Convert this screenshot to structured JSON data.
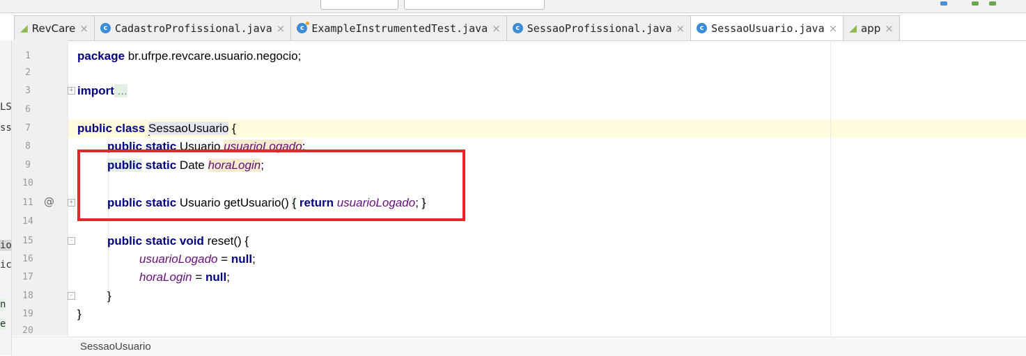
{
  "tabs": [
    {
      "label": "RevCare",
      "icon": "android-icon",
      "active": false
    },
    {
      "label": "CadastroProfissional.java",
      "icon": "java-class-icon",
      "active": false
    },
    {
      "label": "ExampleInstrumentedTest.java",
      "icon": "java-test-class-icon",
      "active": false
    },
    {
      "label": "SessaoProfissional.java",
      "icon": "java-class-icon",
      "active": false
    },
    {
      "label": "SessaoUsuario.java",
      "icon": "java-class-icon",
      "active": true
    },
    {
      "label": "app",
      "icon": "android-icon",
      "active": false
    }
  ],
  "close_glyph": "×",
  "class_icon_letter": "c",
  "left_strip": [
    "LS",
    "ss",
    "io",
    "ic",
    "n",
    "e"
  ],
  "gutter": {
    "line_numbers": [
      "1",
      "2",
      "3",
      "6",
      "7",
      "8",
      "9",
      "10",
      "11",
      "14",
      "15",
      "16",
      "17",
      "18",
      "19",
      "20"
    ],
    "override_marker": "@"
  },
  "code": {
    "l1_kw": "package",
    "l1_rest": " br.ufrpe.revcare.usuario.negocio;",
    "l3_kw": "import",
    "l3_rest": " ...",
    "l7_kw": "public class ",
    "l7_class_first": "S",
    "l7_class_rest": "essaoUsuario",
    "l7_brace": " {",
    "l8_kw": "public static",
    "l8_type": " Usuario ",
    "l8_field": "usuarioLogado",
    "l8_end": ";",
    "l9_kw1": "public",
    "l9_kw2": " static",
    "l9_type": " Date ",
    "l9_field": "horaLogin",
    "l9_end": ";",
    "l11_kw": "public static",
    "l11_type": " Usuario getUsuario() ",
    "l11_lbrace": "{",
    "l11_ret": " return ",
    "l11_field": "usuarioLogado",
    "l11_semi": ";",
    "l11_rbrace": "}",
    "l15_kw": "public static void",
    "l15_rest": " reset() {",
    "l16_field": "usuarioLogado",
    "l16_eq": " = ",
    "l16_null": "null",
    "l16_end": ";",
    "l17_field": "horaLogin",
    "l17_eq": " = ",
    "l17_null": "null",
    "l17_end": ";",
    "l18": "}",
    "l19": "}"
  },
  "breadcrumb": "SessaoUsuario",
  "colors": {
    "keyword": "#000080",
    "field": "#660e7a",
    "highlight_box": "#e5262a",
    "caret_line": "#fffbdc"
  }
}
